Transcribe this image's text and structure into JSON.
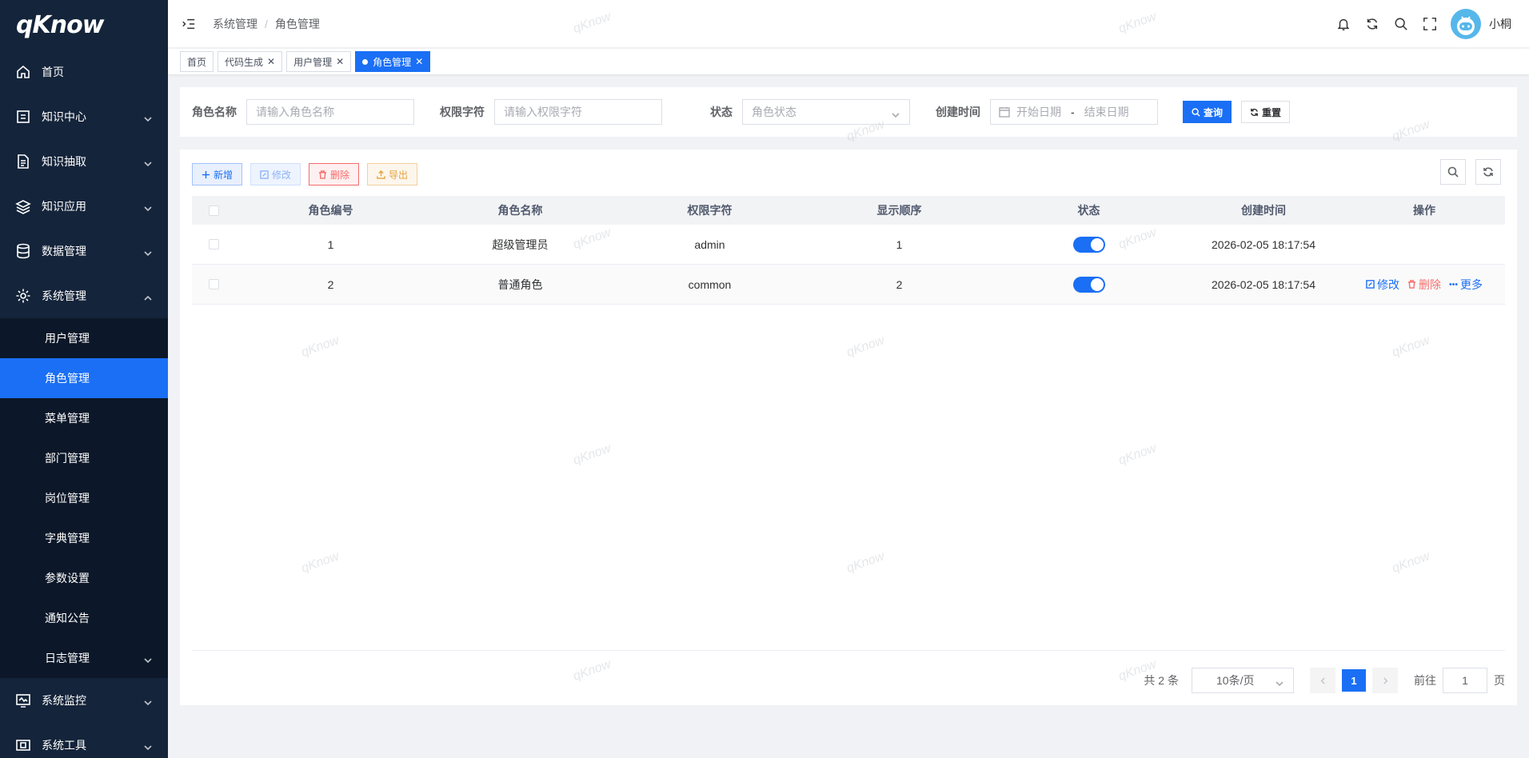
{
  "logo": {
    "text": "qKnow"
  },
  "sidebar": {
    "items": [
      {
        "label": "首页",
        "icon": "home-icon"
      },
      {
        "label": "知识中心",
        "icon": "book-icon"
      },
      {
        "label": "知识抽取",
        "icon": "document-icon"
      },
      {
        "label": "知识应用",
        "icon": "layers-icon"
      },
      {
        "label": "数据管理",
        "icon": "database-icon"
      },
      {
        "label": "系统管理",
        "icon": "gear-icon"
      }
    ],
    "sub_items": [
      {
        "label": "用户管理"
      },
      {
        "label": "角色管理"
      },
      {
        "label": "菜单管理"
      },
      {
        "label": "部门管理"
      },
      {
        "label": "岗位管理"
      },
      {
        "label": "字典管理"
      },
      {
        "label": "参数设置"
      },
      {
        "label": "通知公告"
      },
      {
        "label": "日志管理"
      }
    ],
    "bottom_items": [
      {
        "label": "系统监控",
        "icon": "monitor-icon"
      },
      {
        "label": "系统工具",
        "icon": "tool-icon"
      }
    ]
  },
  "header": {
    "breadcrumb": [
      "系统管理",
      "角色管理"
    ],
    "breadcrumb_sep": "/",
    "username": "小桐"
  },
  "tags": [
    {
      "label": "首页",
      "closable": false
    },
    {
      "label": "代码生成",
      "closable": true
    },
    {
      "label": "用户管理",
      "closable": true
    },
    {
      "label": "角色管理",
      "closable": true,
      "active": true
    }
  ],
  "tag_close": "✕",
  "search": {
    "role_name_label": "角色名称",
    "role_name_placeholder": "请输入角色名称",
    "role_key_label": "权限字符",
    "role_key_placeholder": "请输入权限字符",
    "status_label": "状态",
    "status_placeholder": "角色状态",
    "date_label": "创建时间",
    "start_placeholder": "开始日期",
    "date_sep": "-",
    "end_placeholder": "结束日期",
    "query_button": "查询",
    "reset_button": "重置"
  },
  "toolbar": {
    "add": "新增",
    "edit": "修改",
    "delete": "删除",
    "export": "导出"
  },
  "table": {
    "columns": [
      "角色编号",
      "角色名称",
      "权限字符",
      "显示顺序",
      "状态",
      "创建时间",
      "操作"
    ],
    "rows": [
      {
        "id": "1",
        "name": "超级管理员",
        "key": "admin",
        "order": "1",
        "enabled": true,
        "time": "2026-02-05 18:17:54",
        "ops": []
      },
      {
        "id": "2",
        "name": "普通角色",
        "key": "common",
        "order": "2",
        "enabled": true,
        "time": "2026-02-05 18:17:54",
        "ops": [
          "修改",
          "删除",
          "更多"
        ]
      }
    ]
  },
  "pagination": {
    "total": "共 2 条",
    "page_size": "10条/页",
    "current": "1",
    "goto_label": "前往",
    "goto_value": "1",
    "goto_unit": "页"
  },
  "watermark": "qKnow",
  "colors": {
    "primary": "#1a6ff5",
    "sidebar": "#14243a",
    "danger": "#f56c6c",
    "warning": "#e6a23c"
  }
}
